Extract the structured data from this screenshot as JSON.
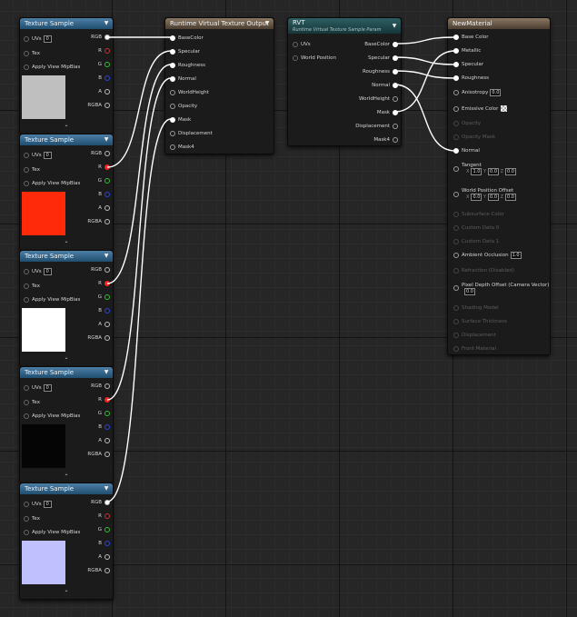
{
  "colors": {
    "wire": "#ffffff",
    "canvas": "#262626",
    "header_blue": "#1f4e6f",
    "header_brown": "#4b3e31",
    "header_teal": "#173639"
  },
  "texture_samples": [
    {
      "title": "Texture Sample",
      "uvs_value": "0",
      "inputs": [
        "UVs",
        "Tex",
        "Apply View MipBias"
      ],
      "outputs": [
        "RGB",
        "R",
        "G",
        "B",
        "A",
        "RGBA"
      ],
      "preview_color": "#bfbfbf"
    },
    {
      "title": "Texture Sample",
      "uvs_value": "0",
      "inputs": [
        "UVs",
        "Tex",
        "Apply View MipBias"
      ],
      "outputs": [
        "RGB",
        "R",
        "G",
        "B",
        "A",
        "RGBA"
      ],
      "preview_color": "#ff2a0a"
    },
    {
      "title": "Texture Sample",
      "uvs_value": "0",
      "inputs": [
        "UVs",
        "Tex",
        "Apply View MipBias"
      ],
      "outputs": [
        "RGB",
        "R",
        "G",
        "B",
        "A",
        "RGBA"
      ],
      "preview_color": "#ffffff"
    },
    {
      "title": "Texture Sample",
      "uvs_value": "0",
      "inputs": [
        "UVs",
        "Tex",
        "Apply View MipBias"
      ],
      "outputs": [
        "RGB",
        "R",
        "G",
        "B",
        "A",
        "RGBA"
      ],
      "preview_color": "#050505"
    },
    {
      "title": "Texture Sample",
      "uvs_value": "0",
      "inputs": [
        "UVs",
        "Tex",
        "Apply View MipBias"
      ],
      "outputs": [
        "RGB",
        "R",
        "G",
        "B",
        "A",
        "RGBA"
      ],
      "preview_color": "#c0c0ff"
    }
  ],
  "rvt_output": {
    "title": "Runtime Virtual Texture Output",
    "inputs": [
      "BaseColor",
      "Specular",
      "Roughness",
      "Normal",
      "WorldHeight",
      "Opacity",
      "Mask",
      "Displacement",
      "Mask4"
    ]
  },
  "rvt_sample": {
    "title": "RVT",
    "subtitle": "Runtime Virtual Texture Sample Param",
    "inputs": [
      "UVs",
      "World Position"
    ],
    "outputs": [
      "BaseColor",
      "Specular",
      "Roughness",
      "Normal",
      "WorldHeight",
      "Mask",
      "Displacement",
      "Mask4"
    ]
  },
  "material": {
    "title": "NewMaterial",
    "base_color": "Base Color",
    "metallic": "Metallic",
    "specular": "Specular",
    "roughness": "Roughness",
    "anisotropy": "Anisotropy",
    "anisotropy_value": "0.0",
    "emissive": "Emissive Color",
    "opacity": "Opacity",
    "opacity_mask": "Opacity Mask",
    "normal": "Normal",
    "tangent": "Tangent",
    "tangent_x": "1.0",
    "tangent_y": "0.0",
    "tangent_z": "0.0",
    "wpo": "World Position Offset",
    "wpo_x": "0.0",
    "wpo_y": "0.0",
    "wpo_z": "0.0",
    "subsurface": "Subsurface Color",
    "custom0": "Custom Data 0",
    "custom1": "Custom Data 1",
    "ao": "Ambient Occlusion",
    "ao_value": "1.0",
    "refraction": "Refraction (Disabled)",
    "pdo": "Pixel Depth Offset (Camera Vector)",
    "pdo_value": "0.0",
    "shading": "Shading Model",
    "thickness": "Surface Thickness",
    "displacement": "Displacement",
    "front": "Front Material"
  },
  "axis": {
    "x": "X",
    "y": "Y",
    "z": "Z"
  },
  "icons": {
    "collapse": "chevron-down-icon",
    "expand": "chevron-down-icon",
    "exec": "arrow-right-icon"
  }
}
